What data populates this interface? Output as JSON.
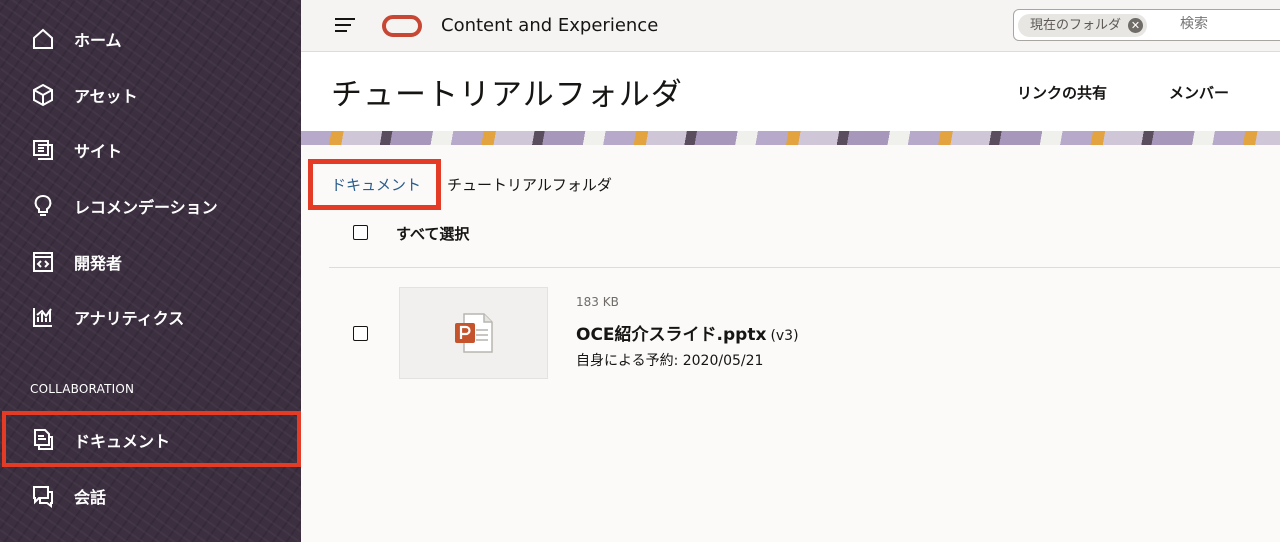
{
  "sidebar": {
    "items": [
      {
        "label": "ホーム",
        "icon": "home-icon"
      },
      {
        "label": "アセット",
        "icon": "cube-icon"
      },
      {
        "label": "サイト",
        "icon": "site-icon"
      },
      {
        "label": "レコメンデーション",
        "icon": "lightbulb-icon"
      },
      {
        "label": "開発者",
        "icon": "code-icon"
      },
      {
        "label": "アナリティクス",
        "icon": "analytics-icon"
      }
    ],
    "section_label": "COLLABORATION",
    "collab_items": [
      {
        "label": "ドキュメント",
        "icon": "document-icon"
      },
      {
        "label": "会話",
        "icon": "conversation-icon"
      }
    ]
  },
  "header": {
    "app_title": "Content and Experience",
    "search_scope": "現在のフォルダ",
    "search_placeholder": "検索"
  },
  "page": {
    "title": "チュートリアルフォルダ",
    "share_link": "リンクの共有",
    "members": "メンバー"
  },
  "breadcrumb": {
    "root": "ドキュメント",
    "current": "チュートリアルフォルダ"
  },
  "list": {
    "select_all": "すべて選択",
    "files": [
      {
        "size": "183 KB",
        "name": "OCE紹介スライド.pptx",
        "version": "(v3)",
        "reserved": "自身による予約: 2020/05/21"
      }
    ]
  },
  "colors": {
    "sidebar_bg": "#3b2f40",
    "highlight": "#e43b26",
    "oracle_red": "#c74634",
    "link": "#2a5d8c"
  }
}
